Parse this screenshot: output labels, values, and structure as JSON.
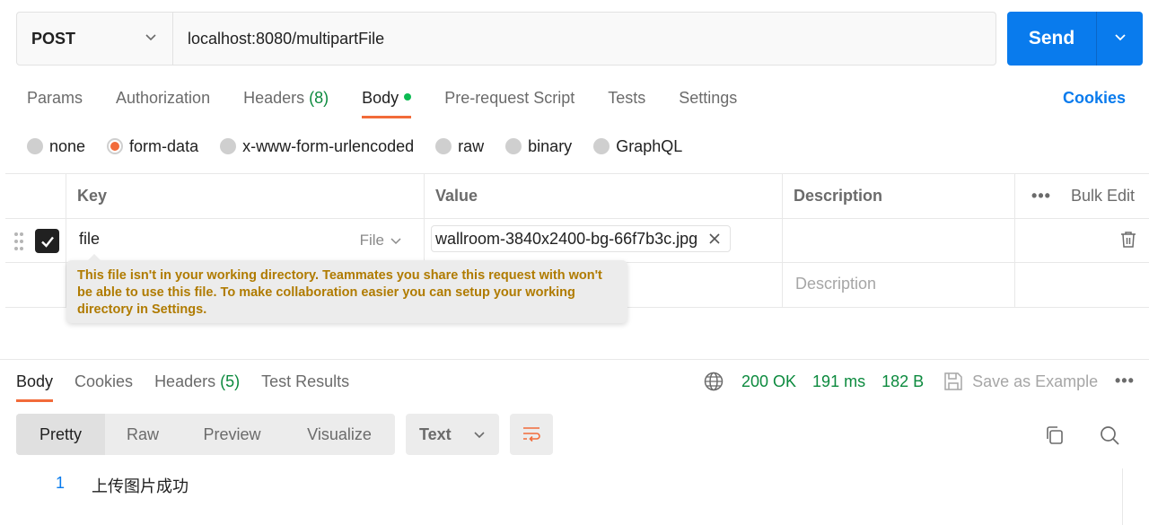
{
  "request": {
    "method": "POST",
    "url": "localhost:8080/multipartFile",
    "send_label": "Send"
  },
  "request_tabs": [
    {
      "label": "Params"
    },
    {
      "label": "Authorization"
    },
    {
      "label": "Headers",
      "count": "(8)"
    },
    {
      "label": "Body",
      "active": true
    },
    {
      "label": "Pre-request Script"
    },
    {
      "label": "Tests"
    },
    {
      "label": "Settings"
    }
  ],
  "cookies_label": "Cookies",
  "body_types": [
    {
      "label": "none"
    },
    {
      "label": "form-data",
      "selected": true
    },
    {
      "label": "x-www-form-urlencoded"
    },
    {
      "label": "raw"
    },
    {
      "label": "binary"
    },
    {
      "label": "GraphQL"
    }
  ],
  "params_table": {
    "headers": {
      "key": "Key",
      "value": "Value",
      "description": "Description",
      "bulk_edit": "Bulk Edit",
      "more": "•••"
    },
    "rows": [
      {
        "checked": true,
        "key": "file",
        "type": "File",
        "value": "wallroom-3840x2400-bg-66f7b3c.jpg"
      }
    ],
    "description_placeholder": "Description"
  },
  "tooltip": "This file isn't in your working directory. Teammates you share this request with won't be able to use this file. To make collaboration easier you can setup your working directory in Settings.",
  "response": {
    "tabs": [
      {
        "label": "Body",
        "active": true
      },
      {
        "label": "Cookies"
      },
      {
        "label": "Headers",
        "count": "(5)"
      },
      {
        "label": "Test Results"
      }
    ],
    "status": "200 OK",
    "time": "191 ms",
    "size": "182 B",
    "save_example_label": "Save as Example",
    "more": "•••",
    "views": [
      {
        "label": "Pretty",
        "active": true
      },
      {
        "label": "Raw"
      },
      {
        "label": "Preview"
      },
      {
        "label": "Visualize"
      }
    ],
    "format": "Text",
    "lines": [
      {
        "no": "1",
        "text": "上传图片成功"
      }
    ]
  },
  "colors": {
    "accent": "#f26b3a",
    "send": "#097bed",
    "status_ok": "#0c8a3e",
    "tooltip_text": "#b07b00"
  }
}
